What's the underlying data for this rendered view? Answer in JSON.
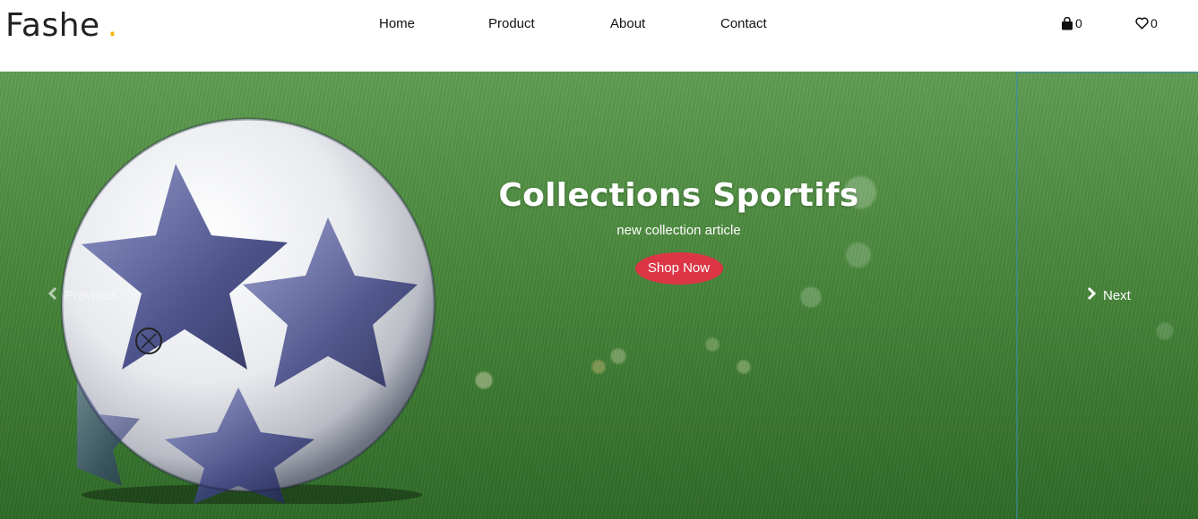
{
  "brand": {
    "name": "Fashe",
    "dot": ".",
    "dot_color": "#f5b400"
  },
  "nav": {
    "links": [
      {
        "label": "Home"
      },
      {
        "label": "Product"
      },
      {
        "label": "About"
      },
      {
        "label": "Contact"
      }
    ],
    "cart": {
      "icon": "shopping-bag-icon",
      "count": "0"
    },
    "wishlist": {
      "icon": "heart-icon",
      "count": "0"
    }
  },
  "hero": {
    "title": "Collections Sportifs",
    "subtitle": "new collection article",
    "cta_label": "Shop Now",
    "cta_color": "#dc3545",
    "prev_label": "Previous",
    "next_label": "Next"
  }
}
